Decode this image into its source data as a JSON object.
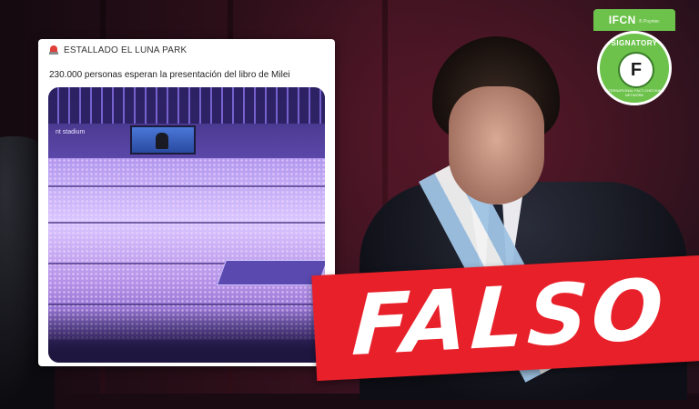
{
  "tweet": {
    "title": "ESTALLADO EL LUNA PARK",
    "text": "230.000 personas esperan la presentación del libro de Milei",
    "photo_caption": "nt stadium"
  },
  "badge": {
    "org": "IFCN",
    "org_sub": "® Poynter.",
    "arc_top": "SIGNATORY",
    "center_letter": "F",
    "arc_bottom": "INTERNATIONAL FACT-CHECKING NETWORK"
  },
  "verdict": {
    "label": "FALSO",
    "color": "#e8202a"
  },
  "colors": {
    "badge_green": "#6cc24a",
    "background": "#2a0e18"
  }
}
